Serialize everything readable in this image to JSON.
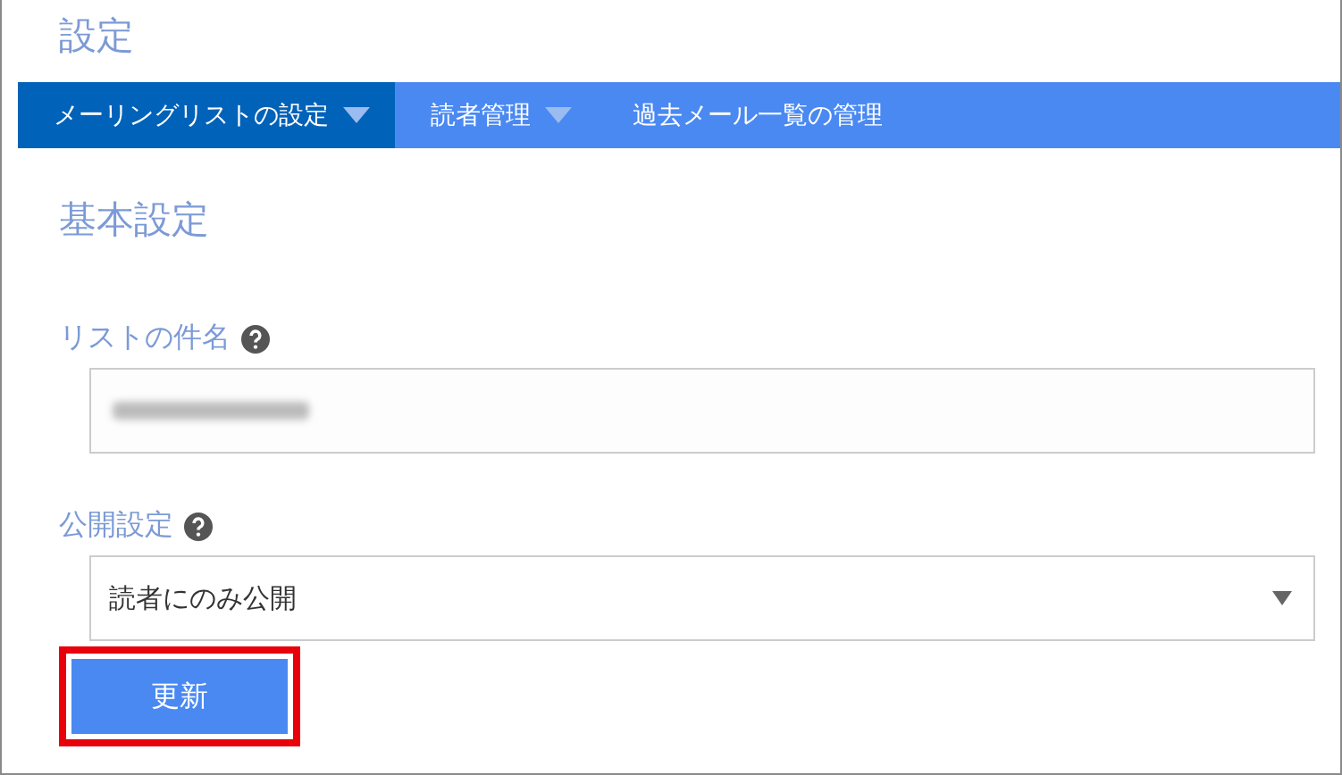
{
  "page_title": "設定",
  "nav": [
    {
      "label": "メーリングリストの設定",
      "dropdown": true,
      "selected": true
    },
    {
      "label": "読者管理",
      "dropdown": true,
      "selected": false
    },
    {
      "label": "過去メール一覧の管理",
      "dropdown": false,
      "selected": false
    }
  ],
  "section_title": "基本設定",
  "fields": [
    {
      "kind": "text",
      "label": "リストの件名",
      "help": true,
      "redacted": true
    },
    {
      "kind": "select",
      "label": "公開設定",
      "help": true,
      "value": "読者にのみ公開"
    }
  ],
  "submit": {
    "label": "更新",
    "highlighted": true
  }
}
